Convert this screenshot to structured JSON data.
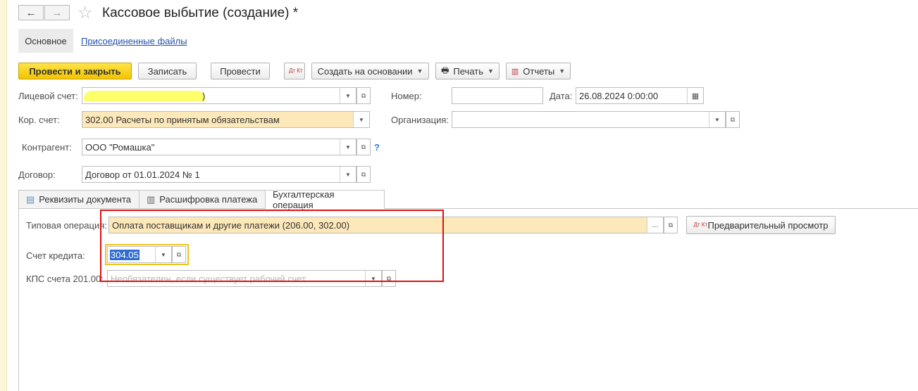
{
  "window": {
    "title": "Кассовое выбытие (создание) *"
  },
  "nav": {
    "back_icon": "←",
    "forward_icon": "→",
    "star_icon": "☆"
  },
  "panels": {
    "main": "Основное",
    "attachments": "Присоединенные файлы"
  },
  "toolbar": {
    "post_close": "Провести и закрыть",
    "save": "Записать",
    "post": "Провести",
    "dtkt_icon": "Дт Кт",
    "create_based": "Создать на основании",
    "print": "Печать",
    "reports": "Отчеты"
  },
  "form": {
    "account_label": "Лицевой счет:",
    "account_value_tail": ")",
    "corr_label": "Кор. счет:",
    "corr_value": "302.00 Расчеты по принятым обязательствам",
    "contractor_label": "Контрагент:",
    "contractor_value": "ООО \"Ромашка\"",
    "help": "?",
    "contract_label": "Договор:",
    "contract_value": "Договор от 01.01.2024 № 1",
    "number_label": "Номер:",
    "number_value": "",
    "date_label": "Дата:",
    "date_value": "26.08.2024  0:00:00",
    "org_label": "Организация:",
    "org_value": ""
  },
  "tabs": [
    {
      "label": "Реквизиты документа"
    },
    {
      "label": "Расшифровка платежа"
    },
    {
      "label": "Бухгалтерская операция"
    }
  ],
  "operation": {
    "type_label": "Типовая операция:",
    "type_value": "Оплата поставщикам и другие платежи (206.00, 302.00)",
    "ellipsis": "...",
    "preview": "Предварительный просмотр",
    "credit_label": "Счет кредита:",
    "credit_value": "304.05",
    "kps_label": "КПС счета 201.00:",
    "kps_placeholder": "Необязателен, если существует рабочий счет"
  }
}
